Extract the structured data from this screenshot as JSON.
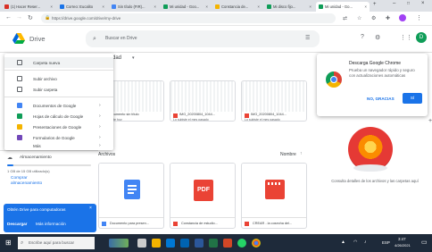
{
  "browser": {
    "tabs": [
      {
        "label": "(1) Hacer Reser..."
      },
      {
        "label": "Correo: Eucalito"
      },
      {
        "label": "Sin título (FIR)..."
      },
      {
        "label": "Mi unidad - Goo..."
      },
      {
        "label": "Constancia de..."
      },
      {
        "label": "Mi disco fijo..."
      },
      {
        "label": "Mi unidad - Go..."
      }
    ],
    "url": "https://drive.google.com/drive/my-drive"
  },
  "header": {
    "app_name": "Drive",
    "search_placeholder": "Buscar en Drive"
  },
  "new_menu": {
    "items": [
      {
        "label": "Carpeta nueva"
      },
      {
        "label": "Subir archivo"
      },
      {
        "label": "Subir carpeta"
      },
      {
        "label": "Documentos de Google"
      },
      {
        "label": "Hojas de cálculo de Google"
      },
      {
        "label": "Presentaciones de Google"
      },
      {
        "label": "Formularios de Google"
      },
      {
        "label": "Más"
      }
    ]
  },
  "sidebar": {
    "storage_label": "Almacenamiento",
    "storage_used": "1 GB de 15 GB utilizado(s)",
    "buy_storage": "Comprar almacenamiento",
    "promo_title": "Obtén Drive para computadoras",
    "promo_download": "Descargar",
    "promo_more": "Más información"
  },
  "main": {
    "breadcrumb": "Mi unidad",
    "recent_cards": [
      {
        "name": "Documento sin título",
        "sub": "Lo subiste hoy"
      },
      {
        "name": "IMG_20200804_1044...",
        "sub": "Lo subiste el mes pasado"
      },
      {
        "name": "IMG_20200804_1044...",
        "sub": "Lo subiste el mes pasado"
      }
    ],
    "files_label": "Archivos",
    "sort_label": "Nombre",
    "files": [
      {
        "name": "Documento para presen..."
      },
      {
        "name": "Constancia de estudio..."
      },
      {
        "name": "CREAR - la cosecha del..."
      }
    ]
  },
  "popup": {
    "title": "Descarga Google Chrome",
    "body": "Prueba un navegador rápido y seguro con actualizaciones automáticas",
    "no_thanks": "NO, GRACIAS",
    "yes": "SÍ"
  },
  "right_panel": {
    "caption": "Consulta detalles de los archivos y las carpetas aquí"
  },
  "taskbar": {
    "search_placeholder": "Escribe aquí para buscar",
    "language": "ESP",
    "time": "3:47",
    "date": "4/26/2021"
  },
  "colors": {
    "accent": "#1a73e8",
    "docs_blue": "#4285f4",
    "pdf_red": "#ea4335",
    "sheets_green": "#0f9d58",
    "slides_yellow": "#f4b400",
    "forms_purple": "#7248b9"
  }
}
